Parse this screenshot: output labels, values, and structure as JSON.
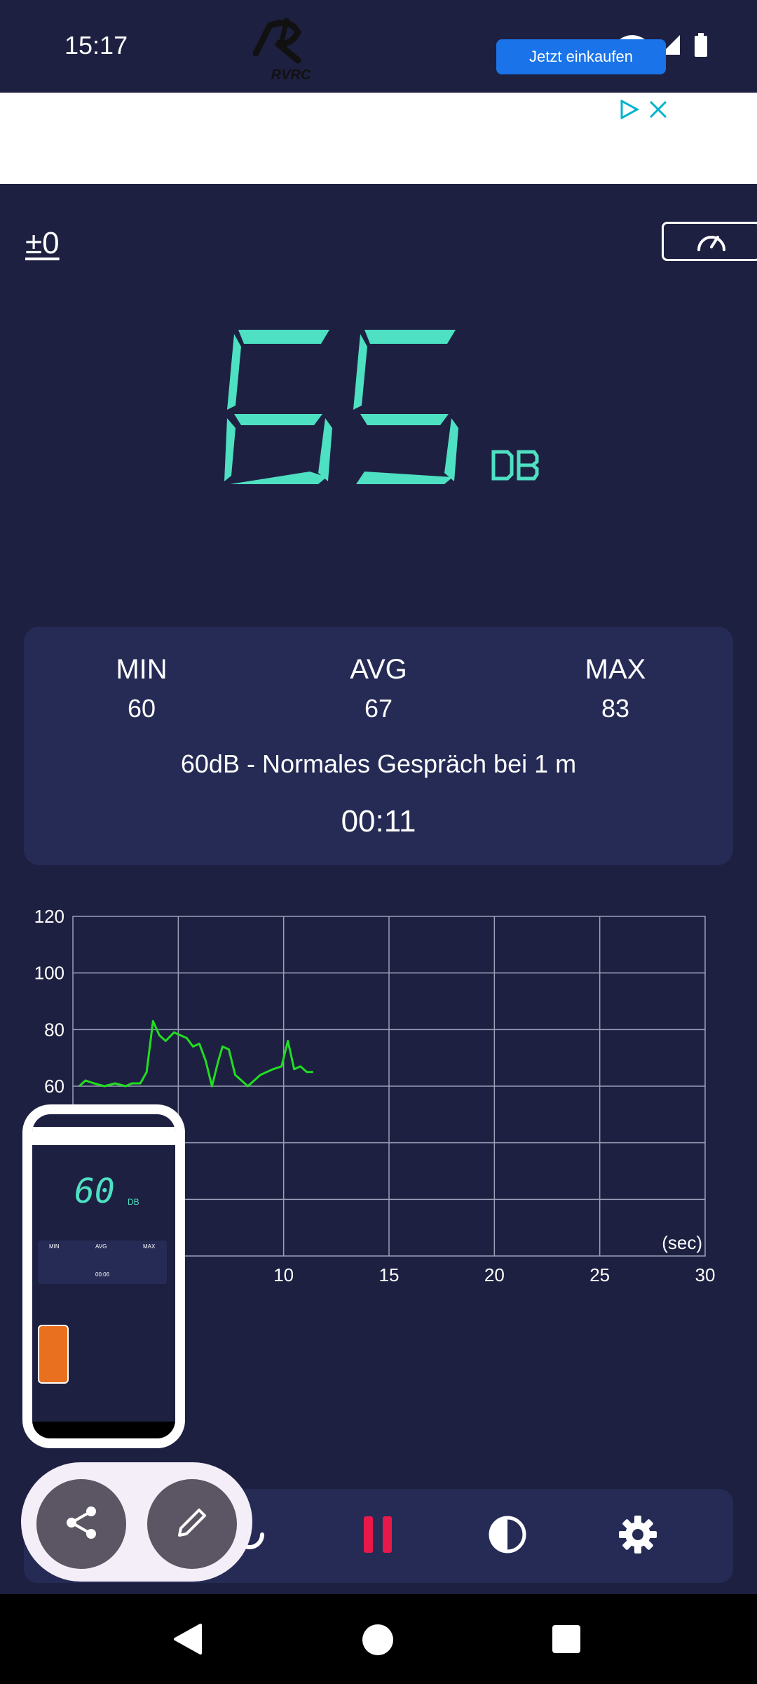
{
  "status_bar": {
    "time": "15:17"
  },
  "ad": {
    "brand": "RVRC",
    "button_label": "Jetzt einkaufen"
  },
  "calibration": "±0",
  "reading": {
    "value": "65",
    "unit": "DB"
  },
  "stats": {
    "min_label": "MIN",
    "min_value": "60",
    "avg_label": "AVG",
    "avg_value": "67",
    "max_label": "MAX",
    "max_value": "83",
    "description": "60dB - Normales Gespräch bei 1 m",
    "elapsed": "00:11"
  },
  "colors": {
    "background": "#1d2041",
    "card": "#252b55",
    "accent": "#4ee0c2",
    "line": "#22dd22",
    "pause": "#e8194a"
  },
  "chart_data": {
    "type": "line",
    "xlabel": "(sec)",
    "ylabel": "",
    "xlim": [
      0,
      30
    ],
    "ylim": [
      0,
      120
    ],
    "y_ticks": [
      120,
      100,
      80,
      60
    ],
    "x_ticks": [
      10,
      15,
      20,
      25,
      30
    ],
    "grid": true,
    "series": [
      {
        "x": [
          0.3,
          0.6,
          1.0,
          1.5,
          2.0,
          2.5,
          2.8,
          3.2,
          3.5,
          3.8,
          4.1,
          4.4,
          4.8,
          5.1,
          5.4,
          5.7,
          6.0,
          6.3,
          6.6,
          6.9,
          7.1,
          7.4,
          7.7,
          8.0,
          8.3,
          8.6,
          8.9,
          9.2,
          9.5,
          9.9,
          10.2,
          10.5,
          10.8,
          11.1,
          11.4
        ],
        "y": [
          60,
          62,
          61,
          60,
          61,
          60,
          61,
          61,
          65,
          83,
          78,
          76,
          79,
          78,
          77,
          74,
          75,
          69,
          60,
          69,
          74,
          73,
          64,
          62,
          60,
          62,
          64,
          65,
          66,
          67,
          76,
          66,
          67,
          65,
          65
        ]
      }
    ]
  },
  "thumbnail": {
    "reading": "60",
    "unit": "DB",
    "min_label": "MIN",
    "avg_label": "AVG",
    "max_label": "MAX",
    "timer": "00:06"
  }
}
